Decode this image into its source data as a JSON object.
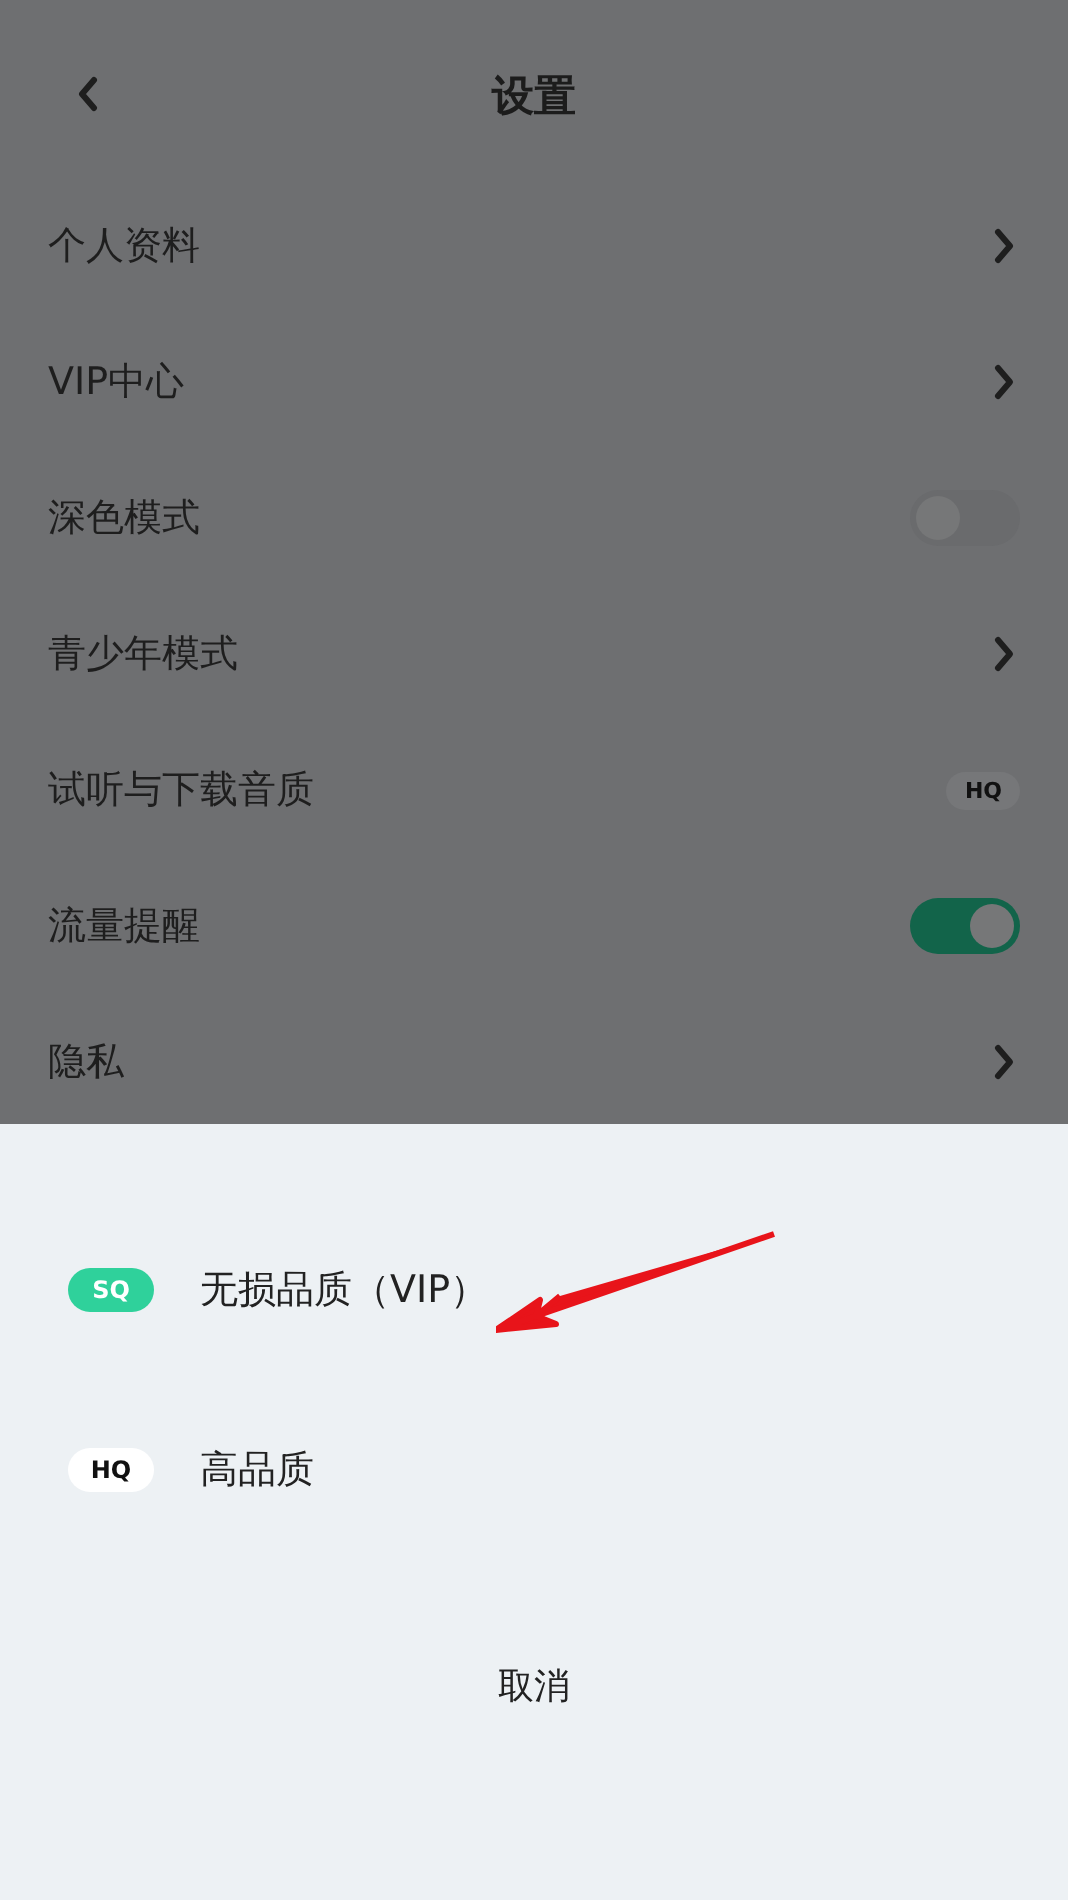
{
  "header": {
    "title": "设置"
  },
  "settings": [
    {
      "label": "个人资料",
      "kind": "link"
    },
    {
      "label": "VIP中心",
      "kind": "link"
    },
    {
      "label": "深色模式",
      "kind": "toggle",
      "on": false
    },
    {
      "label": "青少年模式",
      "kind": "link"
    },
    {
      "label": "试听与下载音质",
      "kind": "badge",
      "badge": "HQ"
    },
    {
      "label": "流量提醒",
      "kind": "toggle",
      "on": true
    },
    {
      "label": "隐私",
      "kind": "link"
    }
  ],
  "sheet": {
    "options": [
      {
        "badge": "SQ",
        "label": "无损品质（VIP）",
        "color": "#2fd19b"
      },
      {
        "badge": "HQ",
        "label": "高品质",
        "color": "#ffffff"
      }
    ],
    "cancel": "取消"
  }
}
